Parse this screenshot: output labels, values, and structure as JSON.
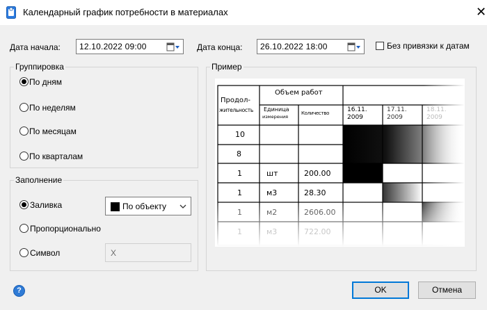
{
  "window": {
    "title": "Календарный график потребности в материалах",
    "close": "✕"
  },
  "dates": {
    "start_label": "Дата начала:",
    "start_value": "12.10.2022 09:00",
    "end_label": "Дата конца:",
    "end_value": "26.10.2022 18:00",
    "unbound_label": "Без привязки к датам",
    "unbound_checked": false
  },
  "grouping": {
    "legend": "Группировка",
    "options": [
      "По дням",
      "По неделям",
      "По месяцам",
      "По кварталам"
    ],
    "selected": "По дням"
  },
  "fill": {
    "legend": "Заполнение",
    "options": [
      "Заливка",
      "Пропорционально",
      "Символ"
    ],
    "selected": "Заливка",
    "color_value": "По объекту",
    "color_swatch": "#000000",
    "symbol_value": "X"
  },
  "preview": {
    "legend": "Пример",
    "col_duration": "Продол-жительность",
    "col_duration_1": "Продол-",
    "col_duration_2": "жительность",
    "col_volume": "Объем работ",
    "col_unit_1": "Единица",
    "col_unit_2": "измерения",
    "col_qty": "Количество",
    "dates": [
      {
        "d": "16.11.",
        "y": "2009"
      },
      {
        "d": "17.11.",
        "y": "2009"
      },
      {
        "d": "18.11.",
        "y": "2009"
      }
    ],
    "rows": [
      {
        "dur": "10",
        "unit": "",
        "qty": ""
      },
      {
        "dur": "8",
        "unit": "",
        "qty": ""
      },
      {
        "dur": "1",
        "unit": "шт",
        "qty": "200.00"
      },
      {
        "dur": "1",
        "unit": "м3",
        "qty": "28.30"
      },
      {
        "dur": "1",
        "unit": "м2",
        "qty": "2606.00"
      },
      {
        "dur": "1",
        "unit": "м3",
        "qty": "722.00"
      }
    ]
  },
  "buttons": {
    "help": "?",
    "ok": "OK",
    "cancel": "Отмена"
  }
}
